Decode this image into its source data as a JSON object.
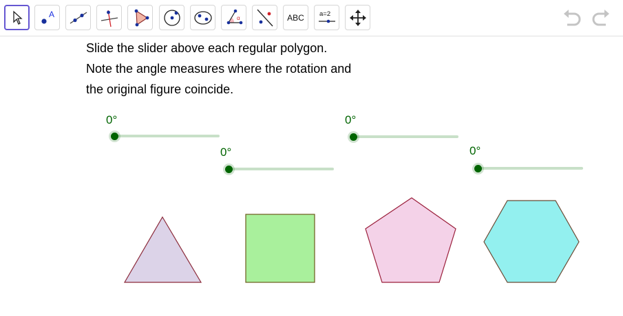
{
  "toolbar": {
    "tools": [
      {
        "name": "move-tool",
        "icon": "arrow-cursor-icon",
        "active": true
      },
      {
        "name": "point-tool",
        "icon": "point-icon",
        "label": "A"
      },
      {
        "name": "line-tool",
        "icon": "line-icon"
      },
      {
        "name": "perpendicular-line-tool",
        "icon": "perpendicular-line-icon"
      },
      {
        "name": "polygon-tool",
        "icon": "polygon-icon"
      },
      {
        "name": "circle-tool",
        "icon": "circle-with-center-icon"
      },
      {
        "name": "ellipse-tool",
        "icon": "ellipse-icon"
      },
      {
        "name": "angle-tool",
        "icon": "angle-icon",
        "label": "α"
      },
      {
        "name": "reflect-tool",
        "icon": "reflect-about-line-icon"
      },
      {
        "name": "text-tool",
        "icon": "text-icon",
        "label": "ABC"
      },
      {
        "name": "slider-tool",
        "icon": "slider-icon",
        "label": "a = 2"
      },
      {
        "name": "move-graphics-view-tool",
        "icon": "move-graphics-view-icon"
      }
    ],
    "undo_icon": "undo-icon",
    "redo_icon": "redo-icon"
  },
  "instructions": {
    "line1": "Slide the slider above each regular polygon.",
    "line2": "Note the angle measures where the rotation and",
    "line3": "the original figure coincide."
  },
  "sliders": {
    "triangle": {
      "value_label": "0°",
      "value": 0
    },
    "square": {
      "value_label": "0°",
      "value": 0
    },
    "pentagon": {
      "value_label": "0°",
      "value": 0
    },
    "hexagon": {
      "value_label": "0°",
      "value": 0
    }
  },
  "colors": {
    "accent": "#6557d2",
    "slider_green": "#006400",
    "triangle_fill": "#dcd3e8",
    "square_fill": "#a9f09c",
    "pentagon_fill": "#f4d2e8",
    "hexagon_fill": "#93f0ef"
  }
}
